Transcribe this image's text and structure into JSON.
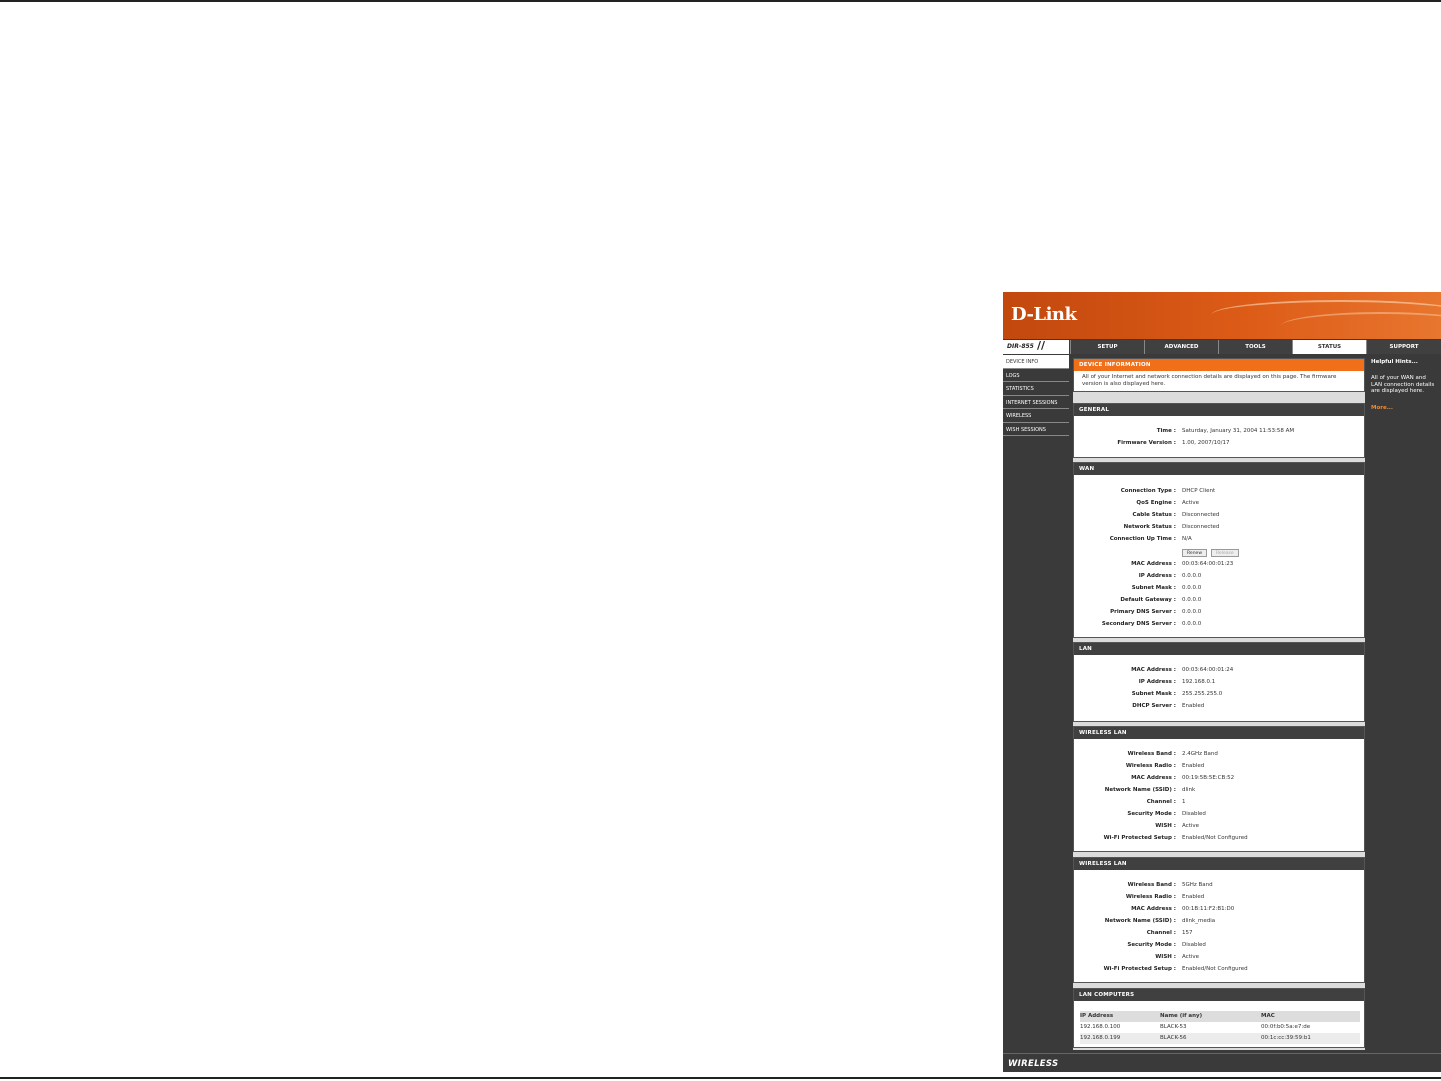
{
  "brand": {
    "logo": "D-Link",
    "model": "DIR-855",
    "model_slash": "//"
  },
  "nav": {
    "tabs": [
      "SETUP",
      "ADVANCED",
      "TOOLS",
      "STATUS",
      "SUPPORT"
    ],
    "active": "STATUS"
  },
  "sidebar": {
    "items": [
      "DEVICE INFO",
      "LOGS",
      "STATISTICS",
      "INTERNET SESSIONS",
      "WIRELESS",
      "WISH SESSIONS"
    ],
    "active": "DEVICE INFO"
  },
  "device_info": {
    "title": "DEVICE INFORMATION",
    "description": "All of your Internet and network connection details are displayed on this page. The firmware version is also displayed here."
  },
  "general": {
    "title": "GENERAL",
    "rows": [
      {
        "label": "Time :",
        "value": "Saturday, January 31, 2004 11:53:58 AM"
      },
      {
        "label": "Firmware Version :",
        "value": "1.00,  2007/10/17"
      }
    ]
  },
  "wan": {
    "title": "WAN",
    "rows_top": [
      {
        "label": "Connection Type :",
        "value": "DHCP Client"
      },
      {
        "label": "QoS Engine :",
        "value": "Active"
      },
      {
        "label": "Cable Status :",
        "value": "Disconnected"
      },
      {
        "label": "Network Status :",
        "value": "Disconnected"
      },
      {
        "label": "Connection Up Time :",
        "value": "N/A"
      }
    ],
    "renew_label": "Renew",
    "release_label": "Release",
    "rows_bottom": [
      {
        "label": "MAC Address :",
        "value": "00:03:64:00:01:23"
      },
      {
        "label": "IP Address :",
        "value": "0.0.0.0"
      },
      {
        "label": "Subnet Mask :",
        "value": "0.0.0.0"
      },
      {
        "label": "Default Gateway :",
        "value": "0.0.0.0"
      },
      {
        "label": "Primary DNS Server :",
        "value": "0.0.0.0"
      },
      {
        "label": "Secondary DNS Server :",
        "value": "0.0.0.0"
      }
    ]
  },
  "lan": {
    "title": "LAN",
    "rows": [
      {
        "label": "MAC Address :",
        "value": "00:03:64:00:01:24"
      },
      {
        "label": "IP Address :",
        "value": "192.168.0.1"
      },
      {
        "label": "Subnet Mask :",
        "value": "255.255.255.0"
      },
      {
        "label": "DHCP Server :",
        "value": "Enabled"
      }
    ]
  },
  "wireless_24": {
    "title": "WIRELESS LAN",
    "rows": [
      {
        "label": "Wireless Band :",
        "value": "2.4GHz Band"
      },
      {
        "label": "Wireless Radio :",
        "value": "Enabled"
      },
      {
        "label": "MAC Address :",
        "value": "00:19:5B:5E:CB:52"
      },
      {
        "label": "Network Name (SSID) :",
        "value": "dlink"
      },
      {
        "label": "Channel :",
        "value": "1"
      },
      {
        "label": "Security Mode :",
        "value": "Disabled"
      },
      {
        "label": "WISH :",
        "value": "Active"
      },
      {
        "label": "Wi-Fi Protected Setup :",
        "value": "Enabled/Not Configured"
      }
    ]
  },
  "wireless_5": {
    "title": "WIRELESS LAN",
    "rows": [
      {
        "label": "Wireless Band :",
        "value": "5GHz Band"
      },
      {
        "label": "Wireless Radio :",
        "value": "Enabled"
      },
      {
        "label": "MAC Address :",
        "value": "00:1B:11:F2:B1:D0"
      },
      {
        "label": "Network Name (SSID) :",
        "value": "dlink_media"
      },
      {
        "label": "Channel :",
        "value": "157"
      },
      {
        "label": "Security Mode :",
        "value": "Disabled"
      },
      {
        "label": "WISH :",
        "value": "Active"
      },
      {
        "label": "Wi-Fi Protected Setup :",
        "value": "Enabled/Not Configured"
      }
    ]
  },
  "lan_computers": {
    "title": "LAN COMPUTERS",
    "headers": [
      "IP Address",
      "Name (if any)",
      "MAC"
    ],
    "rows": [
      [
        "192.168.0.100",
        "BLACK-53",
        "00:0f:b0:5a:e7:de"
      ],
      [
        "192.168.0.199",
        "BLACK-56",
        "00:1c:cc:39:59:b1"
      ]
    ]
  },
  "hints": {
    "title": "Helpful Hints...",
    "text": "All of your WAN and LAN connection details are displayed here.",
    "more": "More..."
  },
  "footer": {
    "label": "WIRELESS"
  }
}
